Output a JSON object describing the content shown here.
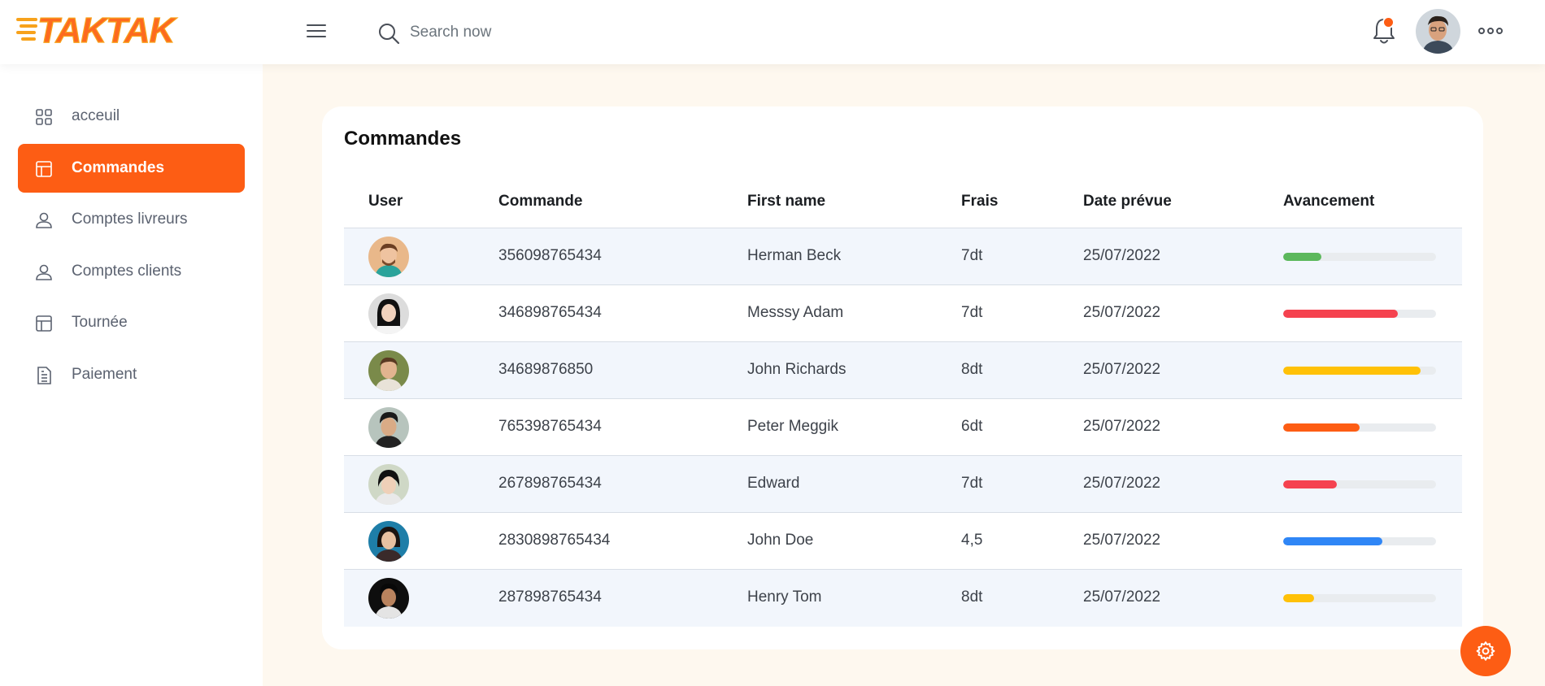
{
  "header": {
    "logo_text": "TAKTAK",
    "search_placeholder": "Search now",
    "notification_dot_color": "#fd5d14",
    "icons": [
      "menu-icon",
      "search-icon",
      "bell-icon",
      "more-horizontal-icon"
    ]
  },
  "sidebar": {
    "items": [
      {
        "label": "acceuil",
        "icon": "grid-icon",
        "active": false
      },
      {
        "label": "Commandes",
        "icon": "layout-icon",
        "active": true
      },
      {
        "label": "Comptes livreurs",
        "icon": "user-icon",
        "active": false
      },
      {
        "label": "Comptes clients",
        "icon": "user-icon",
        "active": false
      },
      {
        "label": "Tournée",
        "icon": "layout-icon",
        "active": false
      },
      {
        "label": "Paiement",
        "icon": "document-icon",
        "active": false
      }
    ]
  },
  "main": {
    "title": "Commandes",
    "columns": {
      "user": "User",
      "commande": "Commande",
      "first_name": "First name",
      "frais": "Frais",
      "date": "Date prévue",
      "avancement": "Avancement"
    },
    "rows": [
      {
        "commande": "356098765434",
        "first_name": "Herman Beck",
        "frais": "7dt",
        "date": "25/07/2022",
        "progress": 0.25,
        "progress_color": "#5cb85c"
      },
      {
        "commande": "346898765434",
        "first_name": "Messsy Adam",
        "frais": "7dt",
        "date": "25/07/2022",
        "progress": 0.75,
        "progress_color": "#f5424f"
      },
      {
        "commande": "34689876850",
        "first_name": "John Richards",
        "frais": "8dt",
        "date": "25/07/2022",
        "progress": 0.9,
        "progress_color": "#ffc107"
      },
      {
        "commande": "765398765434",
        "first_name": "Peter Meggik",
        "frais": "6dt",
        "date": "25/07/2022",
        "progress": 0.5,
        "progress_color": "#fd5d14"
      },
      {
        "commande": "267898765434",
        "first_name": "Edward",
        "frais": "7dt",
        "date": "25/07/2022",
        "progress": 0.35,
        "progress_color": "#f5424f"
      },
      {
        "commande": "2830898765434",
        "first_name": "John Doe",
        "frais": "4,5",
        "date": "25/07/2022",
        "progress": 0.65,
        "progress_color": "#2f86f6"
      },
      {
        "commande": "287898765434",
        "first_name": "Henry Tom",
        "frais": "8dt",
        "date": "25/07/2022",
        "progress": 0.2,
        "progress_color": "#ffc107"
      }
    ]
  },
  "colors": {
    "accent": "#fd5d14",
    "main_bg": "#fef8ef",
    "row_alt_bg": "#f2f6fc"
  },
  "fab_icon": "settings-gear-icon"
}
